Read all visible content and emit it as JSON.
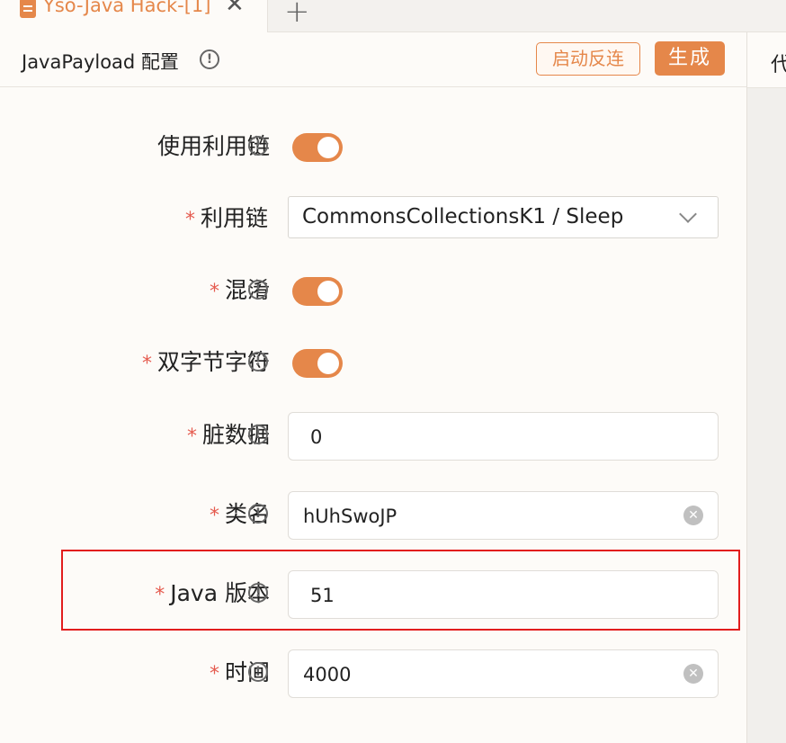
{
  "tab": {
    "title": "Yso-Java Hack-[1]",
    "close_glyph": "✕",
    "add_glyph": "+",
    "icon": "document-icon"
  },
  "header": {
    "title": "JavaPayload 配置",
    "info_glyph": "!",
    "start_reverse_label": "启动反连",
    "generate_label": "生成"
  },
  "right_panel": {
    "header_text": "代"
  },
  "form": {
    "required_mark": "*",
    "use_chain": {
      "label": "使用利用链",
      "enabled": true
    },
    "chain": {
      "label": "利用链",
      "value": "CommonsCollectionsK1 / Sleep"
    },
    "obfuscate": {
      "label": "混淆",
      "enabled": true
    },
    "double_byte": {
      "label": "双字节字符",
      "enabled": true
    },
    "dirty_data": {
      "label": "脏数据",
      "value": "0"
    },
    "class_name": {
      "label": "类名",
      "value": "hUhSwoJP"
    },
    "java_version": {
      "label": "Java 版本",
      "value": "51"
    },
    "time": {
      "label": "时间",
      "value": "4000"
    }
  },
  "colors": {
    "accent": "#e5874a",
    "required": "#e55b4f",
    "highlight": "#e21d1d"
  }
}
